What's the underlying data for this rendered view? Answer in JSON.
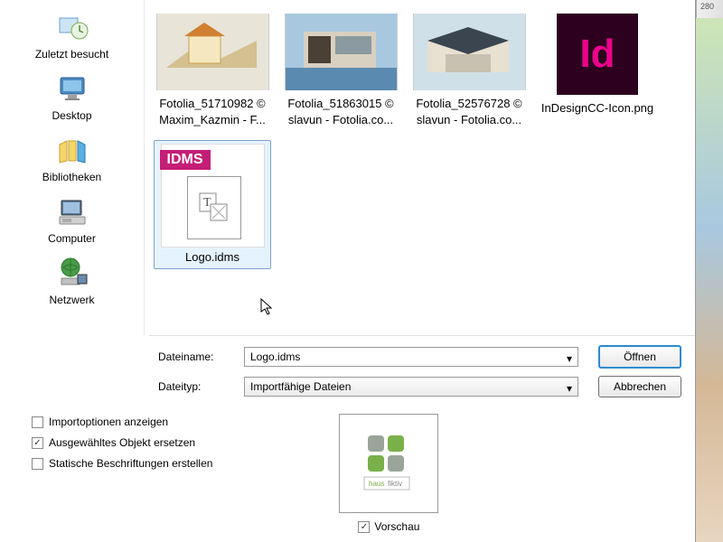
{
  "sidebar": {
    "recent": "Zuletzt besucht",
    "desktop": "Desktop",
    "libraries": "Bibliotheken",
    "computer": "Computer",
    "network": "Netzwerk"
  },
  "files": {
    "f1": {
      "line1": "Fotolia_51710982 ©",
      "line2": "Maxim_Kazmin - F..."
    },
    "f2": {
      "line1": "Fotolia_51863015 ©",
      "line2": "slavun - Fotolia.co..."
    },
    "f3": {
      "line1": "Fotolia_52576728 ©",
      "line2": "slavun - Fotolia.co..."
    },
    "f4": {
      "line1": "InDesignCC-Icon.png"
    },
    "f5": {
      "line1": "Logo.idms"
    }
  },
  "fields": {
    "filename_label": "Dateiname:",
    "filename_value": "Logo.idms",
    "filetype_label": "Dateityp:",
    "filetype_value": "Importfähige Dateien"
  },
  "buttons": {
    "open": "Öffnen",
    "cancel": "Abbrechen"
  },
  "options": {
    "show_import": "Importoptionen anzeigen",
    "replace_selected": "Ausgewähltes Objekt ersetzen",
    "static_captions": "Statische Beschriftungen erstellen",
    "preview": "Vorschau"
  },
  "idms_tag": "IDMS",
  "id_text": "Id",
  "preview_brand": {
    "a": "haus",
    "b": "fiktiv"
  },
  "ruler_mark": "280"
}
